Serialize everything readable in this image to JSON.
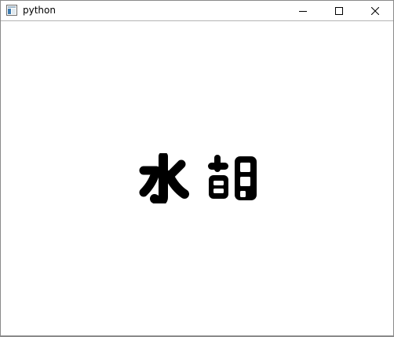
{
  "window": {
    "title": "python",
    "app_icon": "python-window-icon"
  },
  "caption_buttons": {
    "minimize_icon": "minimize-icon",
    "maximize_icon": "maximize-icon",
    "close_icon": "close-icon"
  },
  "canvas": {
    "text": "水胡",
    "text_color": "#000000",
    "background_color": "#ffffff"
  }
}
